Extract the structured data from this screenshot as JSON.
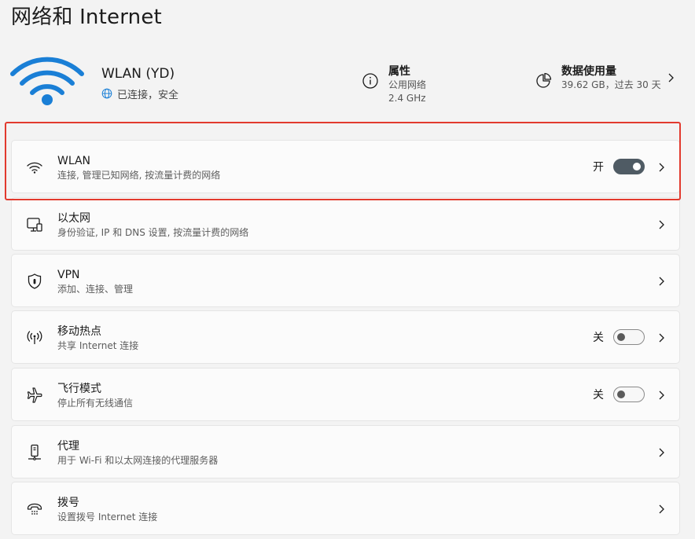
{
  "page": {
    "title": "网络和 Internet"
  },
  "hero": {
    "network_name": "WLAN (YD)",
    "status": "已连接，安全",
    "icon": "wifi-large-icon",
    "accent_color": "#1a7fd6"
  },
  "properties": {
    "title": "属性",
    "line1": "公用网络",
    "line2": "2.4 GHz",
    "icon": "info-icon"
  },
  "data_usage": {
    "title": "数据使用量",
    "detail": "39.62 GB，过去 30 天",
    "icon": "pie-chart-icon"
  },
  "items": [
    {
      "label": "WLAN",
      "desc": "连接, 管理已知网络, 按流量计费的网络",
      "icon": "wifi-icon",
      "state": "开",
      "toggle_on": true,
      "highlighted": true
    },
    {
      "label": "以太网",
      "desc": "身份验证, IP 和 DNS 设置, 按流量计费的网络",
      "icon": "ethernet-icon"
    },
    {
      "label": "VPN",
      "desc": "添加、连接、管理",
      "icon": "shield-icon"
    },
    {
      "label": "移动热点",
      "desc": "共享 Internet 连接",
      "icon": "hotspot-icon",
      "state": "关",
      "toggle_on": false
    },
    {
      "label": "飞行模式",
      "desc": "停止所有无线通信",
      "icon": "airplane-icon",
      "state": "关",
      "toggle_on": false
    },
    {
      "label": "代理",
      "desc": "用于 Wi-Fi 和以太网连接的代理服务器",
      "icon": "proxy-icon"
    },
    {
      "label": "拨号",
      "desc": "设置拨号 Internet 连接",
      "icon": "dialup-icon"
    }
  ],
  "colors": {
    "highlight": "#e23a2e",
    "toggle_on": "#4f5b64"
  }
}
